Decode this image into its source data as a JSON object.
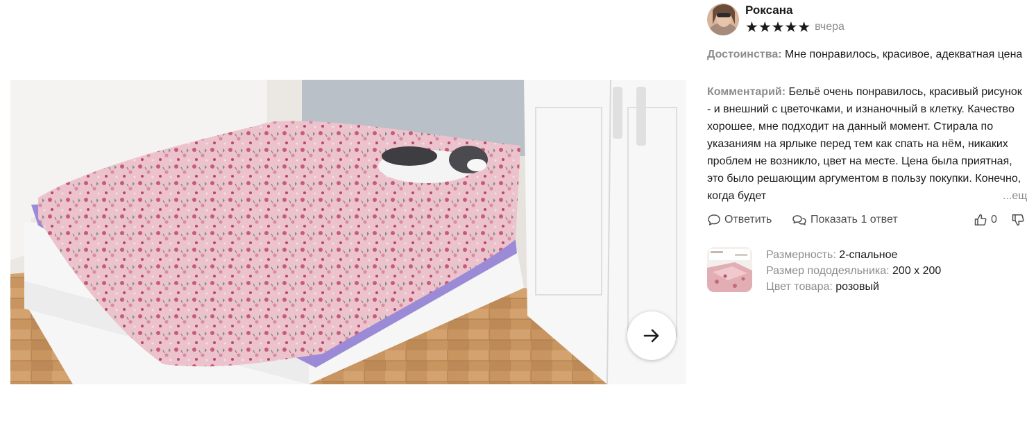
{
  "photo": {
    "subject": "bed-photo",
    "next_icon": "arrow-right-icon"
  },
  "review": {
    "author": "Роксана",
    "stars": "★★★★★",
    "rating": 5,
    "date": "вчера",
    "pros_label": "Достоинства:",
    "pros_text": "Мне понравилось, красивое, адекватная цена",
    "comment_label": "Комментарий:",
    "comment_text": "Бельё очень понравилось, красивый рисунок - и внешний с цветочками, и изнаночный в клетку. Качество хорошее, мне подходит на данный момент. Стирала по указаниям на ярлыке перед тем как спать на нём, никаких проблем не возникло, цвет на месте. Цена была приятная, это было решающим аргументом в пользу покупки. Конечно, когда будет",
    "more_label": "...ещё"
  },
  "actions": {
    "reply_label": "Ответить",
    "show_label": "Показать 1 ответ",
    "likes": "0",
    "reply_icon": "comment-icon",
    "show_icon": "comments-icon",
    "like_icon": "thumbs-up-icon",
    "dislike_icon": "thumbs-down-icon"
  },
  "product": {
    "props": [
      {
        "key": "Размерность:",
        "value": "2-спальное"
      },
      {
        "key": "Размер пододеяльника:",
        "value": "200 х 200"
      },
      {
        "key": "Цвет товара:",
        "value": "розовый"
      }
    ]
  },
  "colors": {
    "label_gray": "#8c8c8c",
    "text": "#1a1a1a",
    "bedding_pink": "#e9b9c3"
  }
}
